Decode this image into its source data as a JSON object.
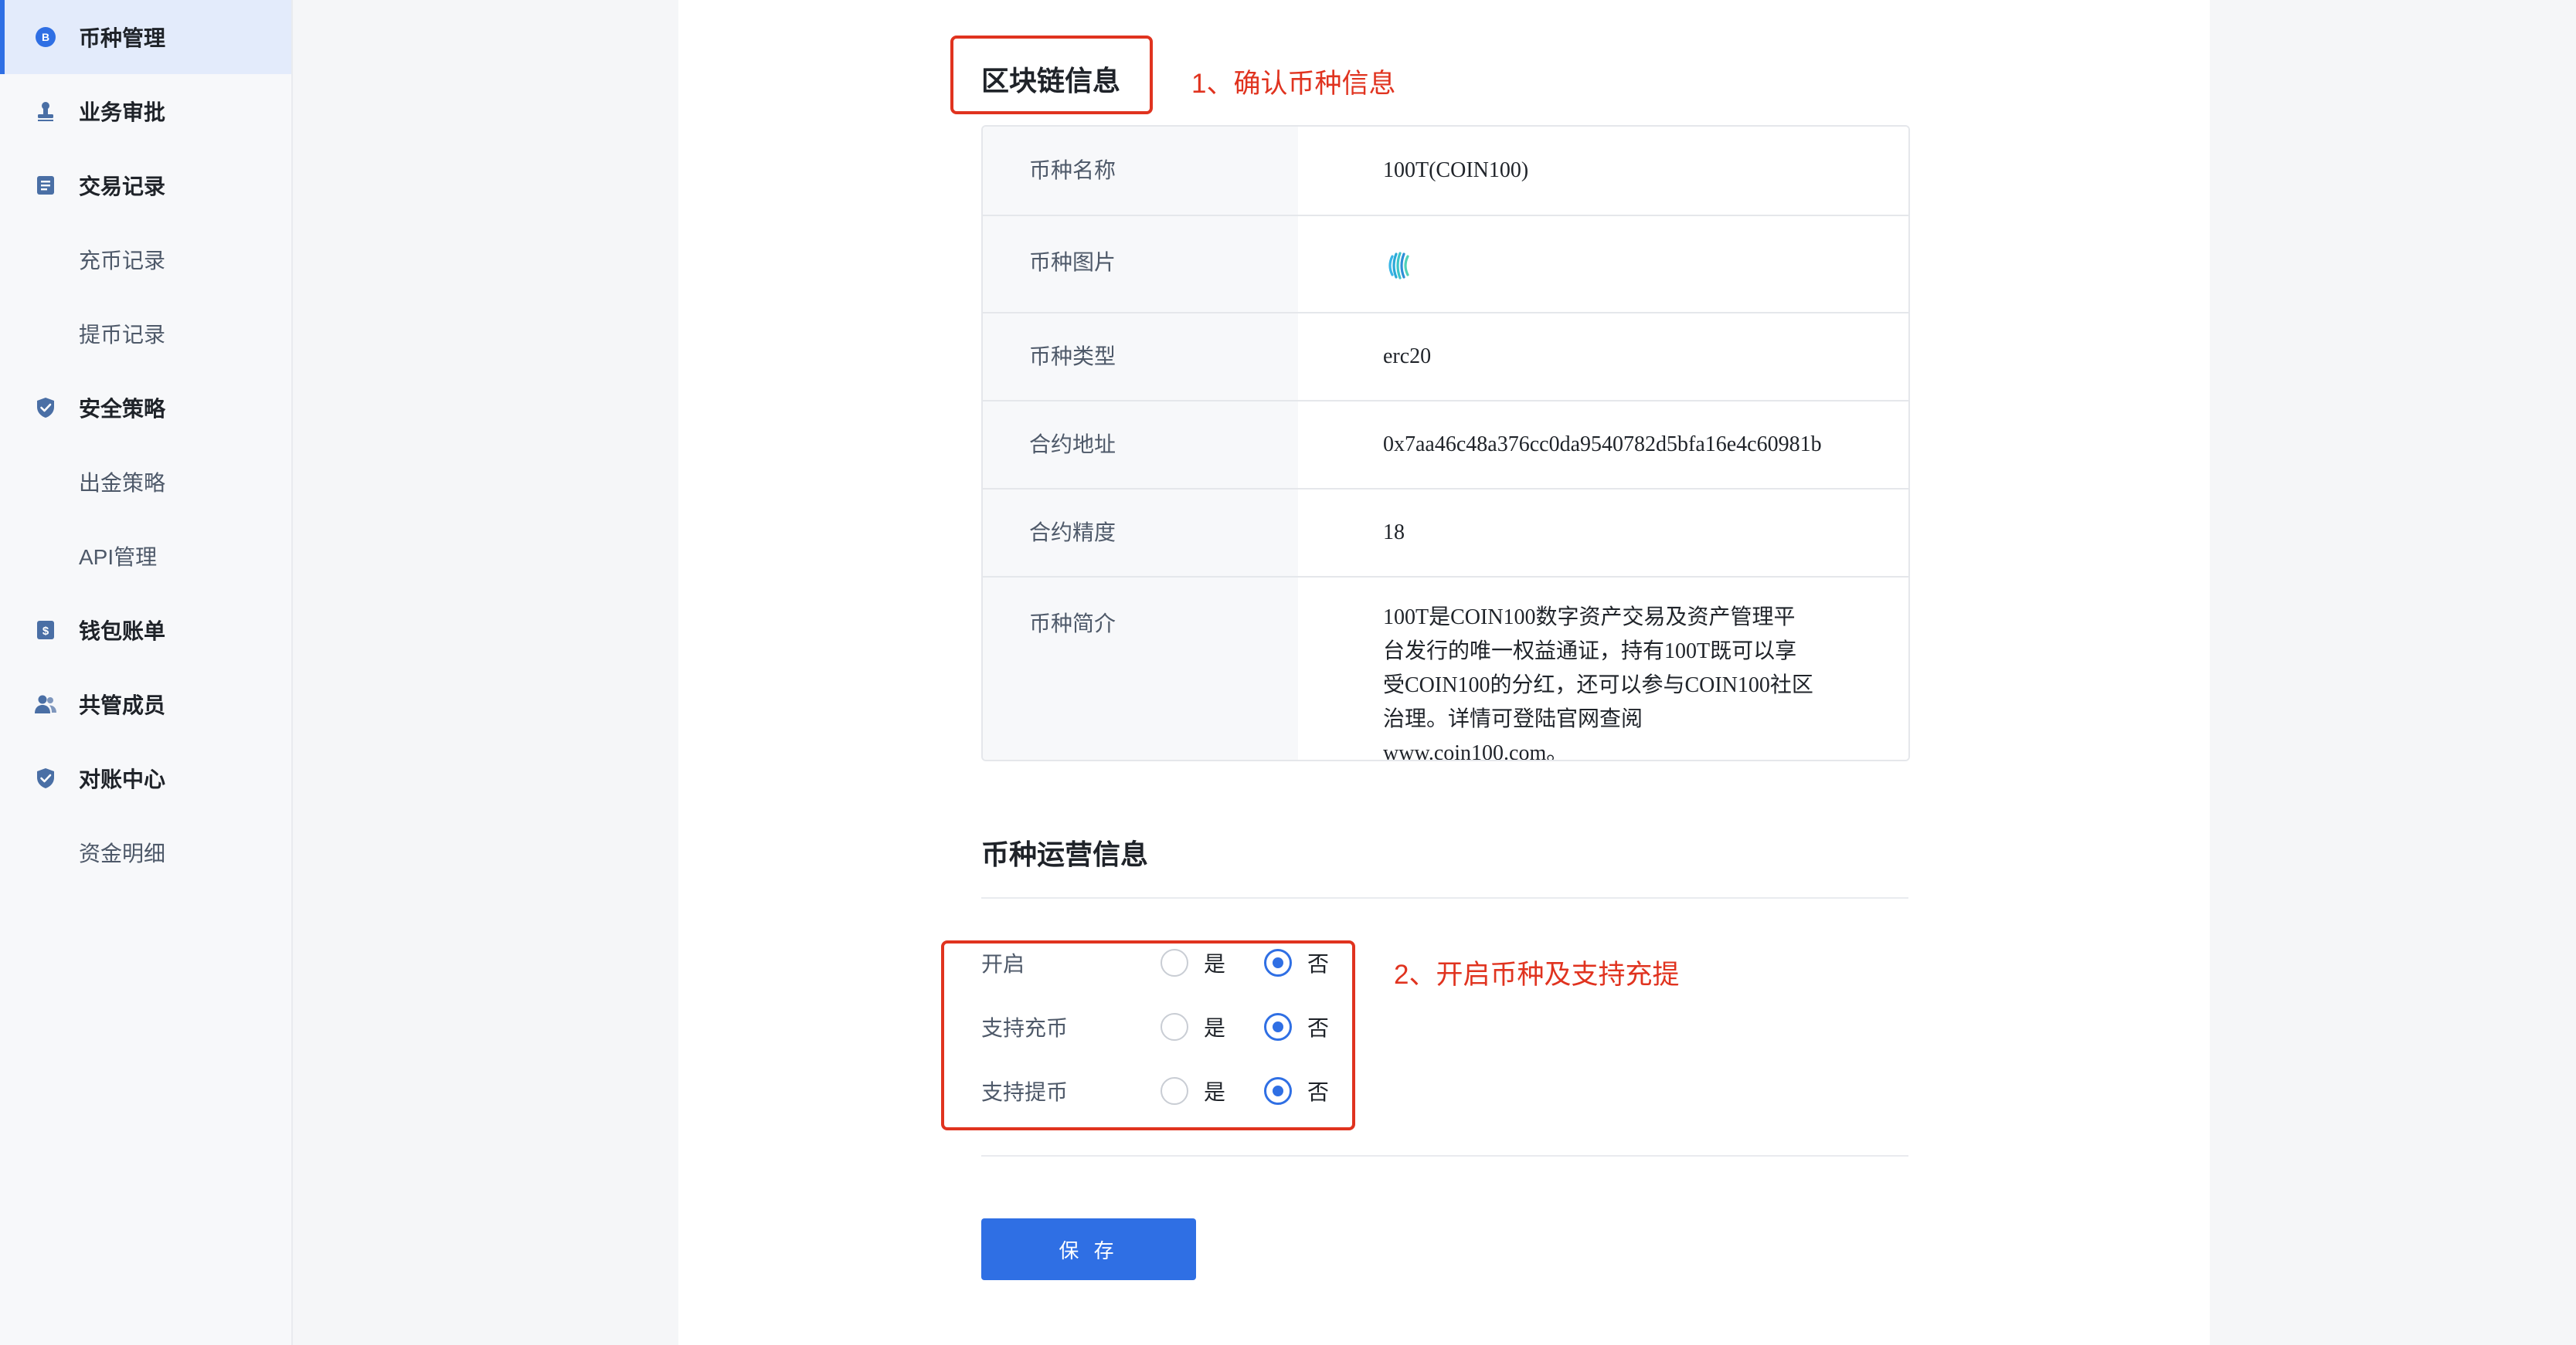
{
  "sidebar": {
    "items": [
      {
        "label": "币种管理",
        "icon": "coin-b-icon",
        "level": 1,
        "active": true
      },
      {
        "label": "业务审批",
        "icon": "stamp-icon",
        "level": 1
      },
      {
        "label": "交易记录",
        "icon": "document-icon",
        "level": 1
      },
      {
        "label": "充币记录",
        "level": 2
      },
      {
        "label": "提币记录",
        "level": 2
      },
      {
        "label": "安全策略",
        "icon": "shield-icon",
        "level": 1
      },
      {
        "label": "出金策略",
        "level": 2
      },
      {
        "label": "API管理",
        "level": 2
      },
      {
        "label": "钱包账单",
        "icon": "wallet-bill-icon",
        "level": 1
      },
      {
        "label": "共管成员",
        "icon": "members-icon",
        "level": 1
      },
      {
        "label": "对账中心",
        "icon": "shield-check-icon",
        "level": 1
      },
      {
        "label": "资金明细",
        "level": 2
      }
    ]
  },
  "blockchain": {
    "title": "区块链信息",
    "annotation": "1、确认币种信息",
    "rows": [
      {
        "label": "币种名称",
        "value": "100T(COIN100)"
      },
      {
        "label": "币种图片",
        "value": "",
        "icon": "coin100-logo-icon"
      },
      {
        "label": "币种类型",
        "value": "erc20"
      },
      {
        "label": "合约地址",
        "value": "0x7aa46c48a376cc0da9540782d5bfa16e4c60981b"
      },
      {
        "label": "合约精度",
        "value": "18"
      },
      {
        "label": "币种简介",
        "value": "100T是COIN100数字资产交易及资产管理平台发行的唯一权益通证，持有100T既可以享受COIN100的分红，还可以参与COIN100社区治理。详情可登陆官网查阅www.coin100.com。"
      }
    ]
  },
  "operations": {
    "title": "币种运营信息",
    "annotation": "2、开启币种及支持充提",
    "rows": [
      {
        "label": "开启",
        "yes": "是",
        "no": "否",
        "selected": "否"
      },
      {
        "label": "支持充币",
        "yes": "是",
        "no": "否",
        "selected": "否"
      },
      {
        "label": "支持提币",
        "yes": "是",
        "no": "否",
        "selected": "否"
      }
    ]
  },
  "save_label": "保 存",
  "colors": {
    "accent": "#2f6fe4",
    "annotation": "#e0331f",
    "sidebar_active_bg": "#e3ebfb"
  }
}
